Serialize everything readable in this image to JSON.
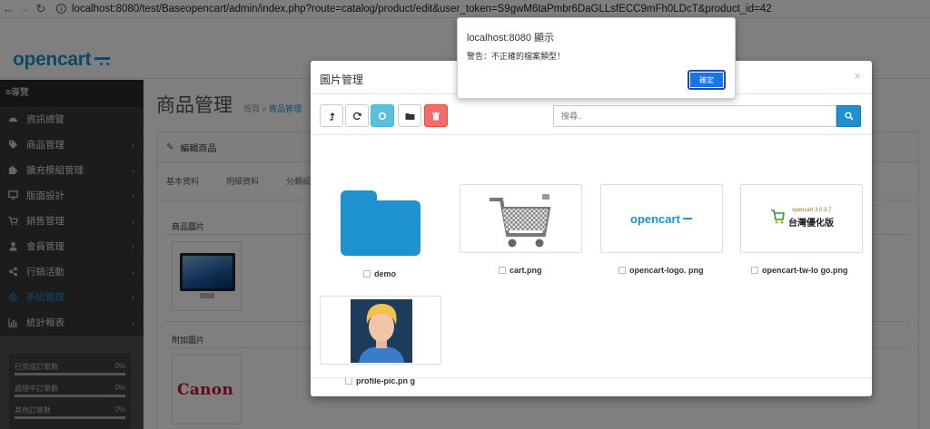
{
  "browser": {
    "url": "localhost:8080/test/Baseopencart/admin/index.php?route=catalog/product/edit&user_token=S9gwM6taPmbr6DaGLLsfECC9mFh0LDcT&product_id=42"
  },
  "header": {
    "logo_text": "opencart"
  },
  "sidebar": {
    "nav_title": "≡導覽",
    "items": [
      {
        "label": "資訊總覽",
        "icon": "dashboard-icon",
        "arrow": false
      },
      {
        "label": "商品管理",
        "icon": "tags-icon",
        "arrow": true
      },
      {
        "label": "擴充模組管理",
        "icon": "puzzle-icon",
        "arrow": true
      },
      {
        "label": "版面設計",
        "icon": "monitor-icon",
        "arrow": true
      },
      {
        "label": "銷售管理",
        "icon": "cart-icon",
        "arrow": true
      },
      {
        "label": "會員管理",
        "icon": "user-icon",
        "arrow": true
      },
      {
        "label": "行銷活動",
        "icon": "share-icon",
        "arrow": true
      },
      {
        "label": "系統管理",
        "icon": "gear-icon",
        "arrow": true,
        "active": true
      },
      {
        "label": "統計報表",
        "icon": "bar-chart-icon",
        "arrow": true
      }
    ],
    "stats": [
      {
        "label": "已完成訂單數",
        "value": "0%"
      },
      {
        "label": "處理中訂單數",
        "value": "0%"
      },
      {
        "label": "其他訂單數",
        "value": "0%"
      }
    ]
  },
  "content": {
    "page_title": "商品管理",
    "breadcrumb": {
      "home": "首頁",
      "sep": "»",
      "current": "商品管理"
    },
    "panel_title": "編輯商品",
    "tabs": [
      "基本資料",
      "明細資料",
      "分類設定"
    ],
    "section_product_image": "商品圖片",
    "section_additional_image": "附加圖片",
    "canon_text": "Canon"
  },
  "modal": {
    "title": "圖片管理",
    "close": "×",
    "search_placeholder": "搜尋..",
    "files": [
      {
        "name": "demo",
        "type": "folder"
      },
      {
        "name": "cart.png",
        "type": "image"
      },
      {
        "name": "opencart-logo. png",
        "type": "image"
      },
      {
        "name": "opencart-tw-lo go.png",
        "type": "image"
      },
      {
        "name": "profile-pic.pn g",
        "type": "image"
      }
    ],
    "opencart_logo_text": "opencart",
    "tw_logo_small": "opencart 3.0.3.7",
    "tw_logo_big": "台灣優化版"
  },
  "alert": {
    "title": "localhost:8080 顯示",
    "message": "警告：不正確的檔案類型！",
    "ok_label": "確定"
  },
  "colors": {
    "brand_blue": "#1e91cf",
    "sidebar_dark": "#383838",
    "danger": "#f56b6b",
    "info": "#5bc0de",
    "dialog_button": "#1a73e8"
  }
}
